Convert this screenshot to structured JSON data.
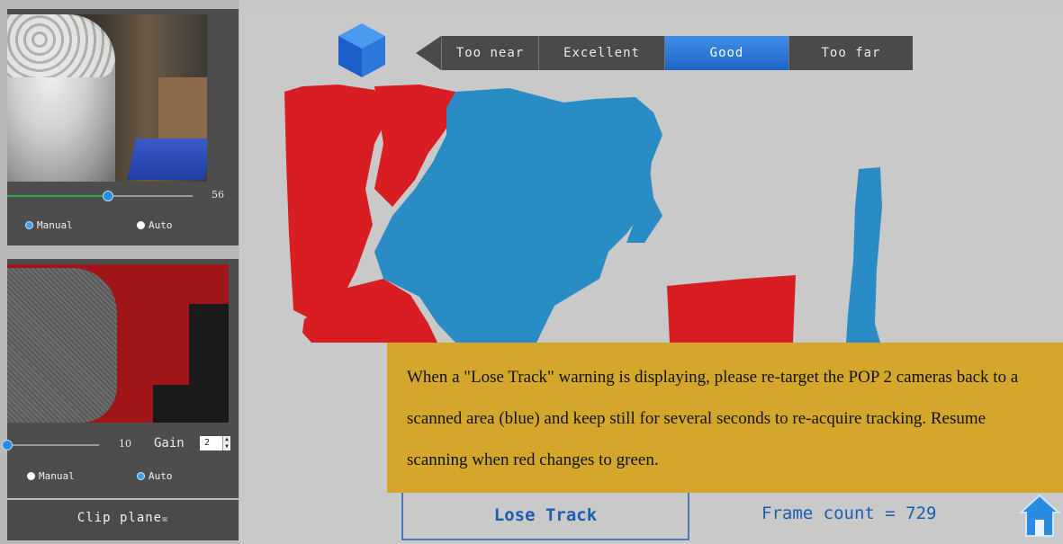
{
  "left_panel": {
    "camera": {
      "slider_value": "56",
      "slider_fraction": 0.55,
      "mode_manual": "Manual",
      "mode_auto": "Auto",
      "selected_mode": "Manual"
    },
    "depth": {
      "slider_value": "10",
      "slider_fraction": 0.0,
      "gain_label": "Gain",
      "gain_value": "2",
      "mode_manual": "Manual",
      "mode_auto": "Auto",
      "selected_mode": "Auto"
    },
    "clip_plane_label": "Clip plane"
  },
  "distance_bar": {
    "segments": [
      "Too near",
      "Excellent",
      "Good",
      "Too far"
    ],
    "active": "Good"
  },
  "message": "When a \"Lose Track\" warning is displaying, please re-target the POP 2 cameras back to a scanned area (blue) and keep still for several seconds to re-acquire tracking. Resume scanning when red changes to green.",
  "status": {
    "warning": "Lose Track",
    "frame_count": "Frame count = 729"
  },
  "colors": {
    "tracked": "#2a8cc4",
    "lost": "#d81e22",
    "callout": "#d4a72c",
    "accent": "#1e64c8"
  },
  "icons": [
    "cube-icon",
    "home-icon",
    "checkbox-icon"
  ]
}
